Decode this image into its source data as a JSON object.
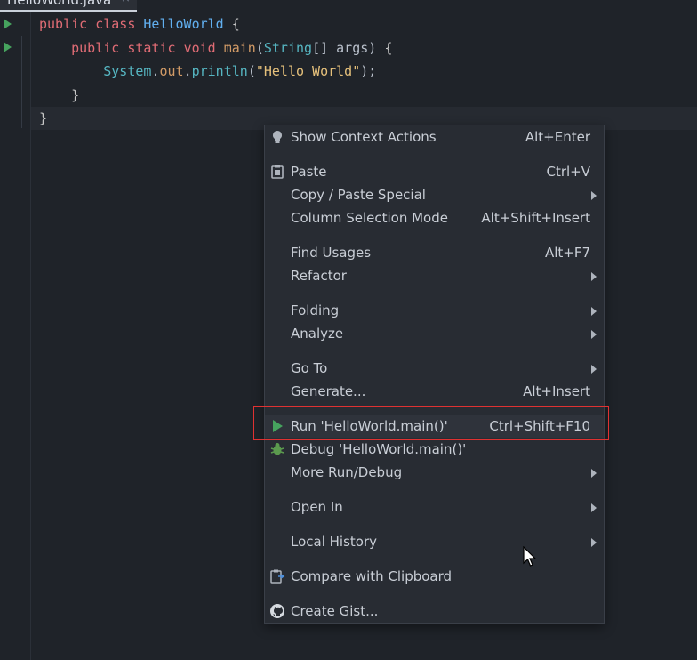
{
  "editor": {
    "tab": {
      "title": "HelloWorld.java",
      "close_glyph": "×"
    },
    "code": {
      "line1": {
        "kw1": "public",
        "kw2": "class",
        "cls": "HelloWorld",
        "brace": "{"
      },
      "line2": {
        "kw1": "public",
        "kw2": "static",
        "kw3": "void",
        "fn": "main",
        "open": "(",
        "type": "String",
        "arr": "[]",
        "arg": "args",
        "close": ")",
        "brace": "{"
      },
      "line3": {
        "obj": "System",
        "dot1": ".",
        "field": "out",
        "dot2": ".",
        "fn": "println",
        "open": "(",
        "str": "\"Hello World\"",
        "close": ");"
      },
      "line4": {
        "brace": "}"
      },
      "line5": {
        "brace": "}"
      }
    }
  },
  "context_menu": {
    "items": [
      {
        "label": "Show Context Actions",
        "shortcut": "Alt+Enter",
        "icon": "lightbulb-icon"
      },
      {
        "label": "Paste",
        "shortcut": "Ctrl+V",
        "icon": "clipboard-icon"
      },
      {
        "label": "Copy / Paste Special",
        "shortcut": "",
        "submenu": true
      },
      {
        "label": "Column Selection Mode",
        "shortcut": "Alt+Shift+Insert"
      },
      {
        "label": "Find Usages",
        "shortcut": "Alt+F7"
      },
      {
        "label": "Refactor",
        "shortcut": "",
        "submenu": true
      },
      {
        "label": "Folding",
        "shortcut": "",
        "submenu": true
      },
      {
        "label": "Analyze",
        "shortcut": "",
        "submenu": true
      },
      {
        "label": "Go To",
        "shortcut": "",
        "submenu": true
      },
      {
        "label": "Generate...",
        "shortcut": "Alt+Insert"
      },
      {
        "label": "Run 'HelloWorld.main()'",
        "shortcut": "Ctrl+Shift+F10",
        "icon": "run-icon",
        "highlighted": true
      },
      {
        "label": "Debug 'HelloWorld.main()'",
        "shortcut": "",
        "icon": "debug-bug-icon"
      },
      {
        "label": "More Run/Debug",
        "shortcut": "",
        "submenu": true
      },
      {
        "label": "Open In",
        "shortcut": "",
        "submenu": true
      },
      {
        "label": "Local History",
        "shortcut": "",
        "submenu": true
      },
      {
        "label": "Compare with Clipboard",
        "shortcut": "",
        "icon": "compare-clipboard-icon"
      },
      {
        "label": "Create Gist...",
        "shortcut": "",
        "icon": "github-icon"
      }
    ]
  },
  "colors": {
    "highlight_border": "#e03232",
    "run_green": "#46a35e"
  }
}
